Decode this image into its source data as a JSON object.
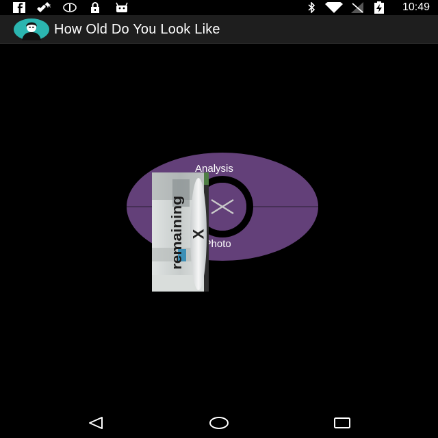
{
  "status_bar": {
    "time": "10:49",
    "icons": [
      "facebook-icon",
      "satellite-icon",
      "eye-icon",
      "lock-icon",
      "android-icon",
      "bluetooth-icon",
      "wifi-icon",
      "no-signal-icon",
      "battery-charging-icon"
    ]
  },
  "app_bar": {
    "title": "How Old Do You Look Like",
    "logo_icon": "face-avatar-icon"
  },
  "menu": {
    "top_label": "Analysis",
    "bottom_label": "d Photo",
    "center_icon": "close-icon",
    "colors": {
      "ring": "#634079",
      "center": "#000000",
      "close": "#c9c9c9",
      "divider": "#2a1e33"
    }
  },
  "overlay": {
    "text": "remaining",
    "close_glyph": "X"
  },
  "nav_bar": {
    "back_icon": "back-triangle-icon",
    "home_icon": "home-circle-icon",
    "recents_icon": "recents-square-icon"
  }
}
